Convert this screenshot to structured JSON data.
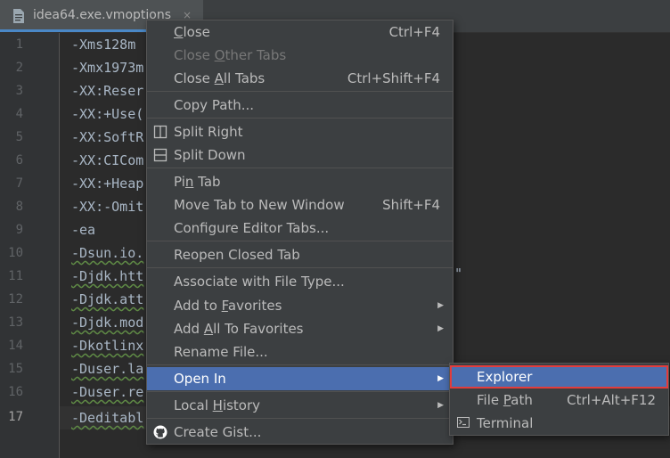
{
  "tab": {
    "filename": "idea64.exe.vmoptions",
    "close_glyph": "×",
    "icon": "file-text-icon"
  },
  "editor": {
    "line_numbers": [
      "1",
      "2",
      "3",
      "4",
      "5",
      "6",
      "7",
      "8",
      "9",
      "10",
      "11",
      "12",
      "13",
      "14",
      "15",
      "16",
      "17"
    ],
    "current_line": "17",
    "lines": [
      "-Xms128m",
      "-Xmx1973m",
      "-XX:Reser",
      "-XX:+Use(",
      "-XX:SoftR",
      "-XX:CICom",
      "-XX:+Heap",
      "-XX:-Omit",
      "-ea",
      "-Dsun.io.",
      "-Djdk.htt",
      "-Djdk.att",
      "-Djdk.mod",
      "-Dkotlinx",
      "-Duser.la",
      "-Duser.re",
      "-Deditabl"
    ],
    "stray_quote": "\""
  },
  "menu": {
    "close": {
      "label": "Close",
      "mnemonic": "C",
      "rest": "lose",
      "shortcut": "Ctrl+F4"
    },
    "close_other": {
      "pre": "Close ",
      "mnemonic": "O",
      "rest": "ther Tabs"
    },
    "close_all": {
      "pre": "Close ",
      "mnemonic": "A",
      "rest": "ll Tabs",
      "shortcut": "Ctrl+Shift+F4"
    },
    "copy_path": {
      "label": "Copy Path..."
    },
    "split_right": {
      "label": "Split Right",
      "icon": "split-vertical-icon"
    },
    "split_down": {
      "label": "Split Down",
      "icon": "split-horizontal-icon"
    },
    "pin_tab": {
      "pre": "Pi",
      "mnemonic": "n",
      "rest": " Tab"
    },
    "move_tab": {
      "label": "Move Tab to New Window",
      "shortcut": "Shift+F4"
    },
    "configure_tabs": {
      "label": "Configure Editor Tabs..."
    },
    "reopen_closed": {
      "label": "Reopen Closed Tab"
    },
    "associate": {
      "label": "Associate with File Type..."
    },
    "add_favorites": {
      "pre": "Add to ",
      "mnemonic": "F",
      "rest": "avorites"
    },
    "add_all_favorites": {
      "pre": "Add ",
      "mnemonic": "A",
      "rest": "ll To Favorites"
    },
    "rename_file": {
      "label": "Rename File..."
    },
    "open_in": {
      "label": "Open In"
    },
    "local_history": {
      "pre": "Local ",
      "mnemonic": "H",
      "rest": "istory"
    },
    "create_gist": {
      "label": "Create Gist...",
      "icon": "github-icon"
    },
    "submenu_arrow": "▶"
  },
  "submenu": {
    "explorer": {
      "label": "Explorer"
    },
    "file_path": {
      "pre": "File ",
      "mnemonic": "P",
      "rest": "ath",
      "shortcut": "Ctrl+Alt+F12"
    },
    "terminal": {
      "label": "Terminal",
      "icon": "terminal-icon"
    }
  },
  "colors": {
    "highlight": "#4b6eaf",
    "annotation_box": "#e23c3c",
    "menu_bg": "#3c3f41",
    "editor_bg": "#2b2b2b"
  }
}
